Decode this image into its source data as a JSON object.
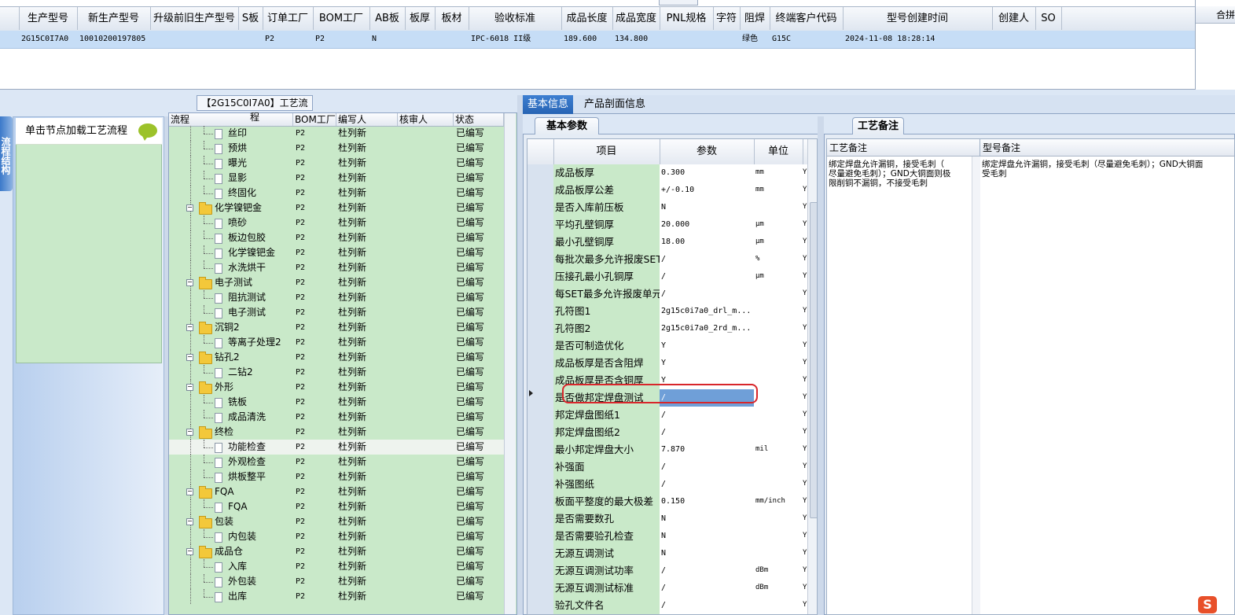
{
  "top_grid": {
    "columns": [
      "生产型号",
      "新生产型号",
      "升级前旧生产型号",
      "S板",
      "订单工厂",
      "BOM工厂",
      "AB板",
      "板厚",
      "板材",
      "验收标准",
      "成品长度",
      "成品宽度",
      "PNL规格",
      "字符",
      "阻焊",
      "终端客户代码",
      "型号创建时间",
      "创建人",
      "SO"
    ],
    "row": [
      "2G15C0I7A0",
      "10010200197805",
      "",
      "",
      "P2",
      "P2",
      "N",
      "",
      "",
      "IPC-6018 II级",
      "189.600",
      "134.800",
      "",
      "",
      "绿色",
      "G15C",
      "2024-11-08 18:28:14",
      "",
      ""
    ],
    "right_panel_header": "合拼"
  },
  "left_panel": {
    "vertical_tab": "流程结构",
    "node_hint": "单击节点加载工艺流程"
  },
  "flow": {
    "caption": "【2G15C0I7A0】工艺流程",
    "headers": [
      "流程",
      "BOM工厂",
      "编写人",
      "核审人",
      "状态"
    ],
    "rows": [
      {
        "name": "丝印",
        "level": 2,
        "bom": "P2",
        "author": "杜列新",
        "status": "已编写"
      },
      {
        "name": "预烘",
        "level": 2,
        "bom": "P2",
        "author": "杜列新",
        "status": "已编写"
      },
      {
        "name": "曝光",
        "level": 2,
        "bom": "P2",
        "author": "杜列新",
        "status": "已编写"
      },
      {
        "name": "显影",
        "level": 2,
        "bom": "P2",
        "author": "杜列新",
        "status": "已编写"
      },
      {
        "name": "终固化",
        "level": 2,
        "bom": "P2",
        "author": "杜列新",
        "status": "已编写"
      },
      {
        "name": "化学镍钯金",
        "level": 1,
        "bom": "P2",
        "author": "杜列新",
        "status": "已编写"
      },
      {
        "name": "喷砂",
        "level": 2,
        "bom": "P2",
        "author": "杜列新",
        "status": "已编写"
      },
      {
        "name": "板边包胶",
        "level": 2,
        "bom": "P2",
        "author": "杜列新",
        "status": "已编写"
      },
      {
        "name": "化学镍钯金",
        "level": 2,
        "bom": "P2",
        "author": "杜列新",
        "status": "已编写"
      },
      {
        "name": "水洗烘干",
        "level": 2,
        "bom": "P2",
        "author": "杜列新",
        "status": "已编写"
      },
      {
        "name": "电子测试",
        "level": 1,
        "bom": "P2",
        "author": "杜列新",
        "status": "已编写"
      },
      {
        "name": "阻抗测试",
        "level": 2,
        "bom": "P2",
        "author": "杜列新",
        "status": "已编写"
      },
      {
        "name": "电子测试",
        "level": 2,
        "bom": "P2",
        "author": "杜列新",
        "status": "已编写"
      },
      {
        "name": "沉铜2",
        "level": 1,
        "bom": "P2",
        "author": "杜列新",
        "status": "已编写"
      },
      {
        "name": "等离子处理2",
        "level": 2,
        "bom": "P2",
        "author": "杜列新",
        "status": "已编写"
      },
      {
        "name": "钻孔2",
        "level": 1,
        "bom": "P2",
        "author": "杜列新",
        "status": "已编写"
      },
      {
        "name": "二钻2",
        "level": 2,
        "bom": "P2",
        "author": "杜列新",
        "status": "已编写"
      },
      {
        "name": "外形",
        "level": 1,
        "bom": "P2",
        "author": "杜列新",
        "status": "已编写"
      },
      {
        "name": "铣板",
        "level": 2,
        "bom": "P2",
        "author": "杜列新",
        "status": "已编写"
      },
      {
        "name": "成品清洗",
        "level": 2,
        "bom": "P2",
        "author": "杜列新",
        "status": "已编写"
      },
      {
        "name": "终检",
        "level": 1,
        "bom": "P2",
        "author": "杜列新",
        "status": "已编写"
      },
      {
        "name": "功能检查",
        "level": 2,
        "bom": "P2",
        "author": "杜列新",
        "status": "已编写",
        "selected": true
      },
      {
        "name": "外观检查",
        "level": 2,
        "bom": "P2",
        "author": "杜列新",
        "status": "已编写"
      },
      {
        "name": "烘板整平",
        "level": 2,
        "bom": "P2",
        "author": "杜列新",
        "status": "已编写"
      },
      {
        "name": "FQA",
        "level": 1,
        "bom": "P2",
        "author": "杜列新",
        "status": "已编写"
      },
      {
        "name": "FQA",
        "level": 2,
        "bom": "P2",
        "author": "杜列新",
        "status": "已编写"
      },
      {
        "name": "包装",
        "level": 1,
        "bom": "P2",
        "author": "杜列新",
        "status": "已编写"
      },
      {
        "name": "内包装",
        "level": 2,
        "bom": "P2",
        "author": "杜列新",
        "status": "已编写"
      },
      {
        "name": "成品仓",
        "level": 1,
        "bom": "P2",
        "author": "杜列新",
        "status": "已编写"
      },
      {
        "name": "入库",
        "level": 2,
        "bom": "P2",
        "author": "杜列新",
        "status": "已编写"
      },
      {
        "name": "外包装",
        "level": 2,
        "bom": "P2",
        "author": "杜列新",
        "status": "已编写"
      },
      {
        "name": "出库",
        "level": 2,
        "bom": "P2",
        "author": "杜列新",
        "status": "已编写"
      }
    ]
  },
  "right_tabs": [
    "基本信息",
    "产品剖面信息"
  ],
  "params": {
    "caption": "基本参数",
    "headers": [
      "项目",
      "参数",
      "单位"
    ],
    "rows": [
      {
        "item": "成品板厚",
        "value": "0.300",
        "unit": "mm",
        "extra": "Y"
      },
      {
        "item": "成品板厚公差",
        "value": "+/-0.10",
        "unit": "mm",
        "extra": "Y"
      },
      {
        "item": "是否入库前压板",
        "value": "N",
        "unit": "",
        "extra": "Y"
      },
      {
        "item": "平均孔壁铜厚",
        "value": "20.000",
        "unit": "μm",
        "extra": "Y"
      },
      {
        "item": "最小孔壁铜厚",
        "value": "18.00",
        "unit": "μm",
        "extra": "Y"
      },
      {
        "item": "每批次最多允许报废SET",
        "value": "/",
        "unit": "%",
        "extra": "Y"
      },
      {
        "item": "压接孔最小孔铜厚",
        "value": "/",
        "unit": "μm",
        "extra": "Y"
      },
      {
        "item": "每SET最多允许报废单元",
        "value": "/",
        "unit": "",
        "extra": "Y"
      },
      {
        "item": "孔符图1",
        "value": "2g15c0i7a0_drl_m...",
        "unit": "",
        "extra": "Y"
      },
      {
        "item": "孔符图2",
        "value": "2g15c0i7a0_2rd_m...",
        "unit": "",
        "extra": "Y"
      },
      {
        "item": "是否可制造优化",
        "value": "Y",
        "unit": "",
        "extra": "Y"
      },
      {
        "item": "成品板厚是否含阻焊",
        "value": "Y",
        "unit": "",
        "extra": "Y"
      },
      {
        "item": "成品板厚是否含铜厚",
        "value": "Y",
        "unit": "",
        "extra": "Y"
      },
      {
        "item": "是否做邦定焊盘测试",
        "value": "/",
        "unit": "",
        "extra": "Y",
        "editing": true
      },
      {
        "item": "邦定焊盘图纸1",
        "value": "/",
        "unit": "",
        "extra": "Y"
      },
      {
        "item": "邦定焊盘图纸2",
        "value": "/",
        "unit": "",
        "extra": "Y"
      },
      {
        "item": "最小邦定焊盘大小",
        "value": "7.870",
        "unit": "mil",
        "extra": "Y"
      },
      {
        "item": "补强面",
        "value": "/",
        "unit": "",
        "extra": "Y"
      },
      {
        "item": "补强图纸",
        "value": "/",
        "unit": "",
        "extra": "Y"
      },
      {
        "item": "板面平整度的最大极差",
        "value": "0.150",
        "unit": "mm/inch",
        "extra": "Y"
      },
      {
        "item": "是否需要数孔",
        "value": "N",
        "unit": "",
        "extra": "Y"
      },
      {
        "item": "是否需要验孔检查",
        "value": "N",
        "unit": "",
        "extra": "Y"
      },
      {
        "item": "无源互调测试",
        "value": "N",
        "unit": "",
        "extra": "Y"
      },
      {
        "item": "无源互调测试功率",
        "value": "/",
        "unit": "dBm",
        "extra": "Y"
      },
      {
        "item": "无源互调测试标准",
        "value": "/",
        "unit": "dBm",
        "extra": "Y"
      },
      {
        "item": "验孔文件名",
        "value": "/",
        "unit": "",
        "extra": "Y"
      }
    ]
  },
  "notes": {
    "caption": "工艺备注",
    "process_note_header": "工艺备注",
    "process_note": "绑定焊盘允许漏铜，接受毛刺（\n尽量避免毛刺）；GND大铜面则极\n限削铜不漏铜，不接受毛刺",
    "model_note_header": "型号备注",
    "model_note": "绑定焊盘允许漏铜，接受毛刺（尽量避免毛刺）；GND大铜面\n受毛刺"
  },
  "ime_logo": "S"
}
